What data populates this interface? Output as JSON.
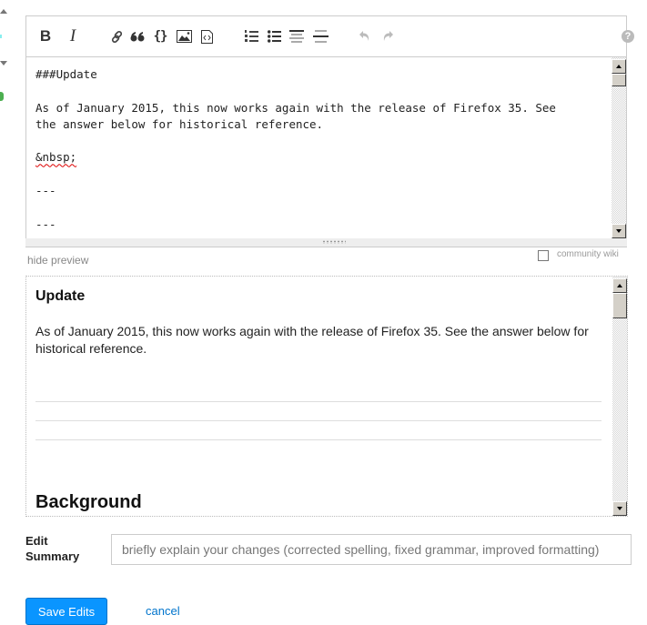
{
  "toolbar": {
    "buttons": [
      {
        "name": "bold",
        "icon": "bold-icon",
        "label": "B"
      },
      {
        "name": "italic",
        "icon": "italic-icon",
        "label": "I"
      },
      {
        "name": "link",
        "icon": "link-icon"
      },
      {
        "name": "blockquote",
        "icon": "quote-icon"
      },
      {
        "name": "code",
        "icon": "code-braces-icon",
        "label": "{}"
      },
      {
        "name": "image",
        "icon": "image-icon"
      },
      {
        "name": "snippet",
        "icon": "snippet-icon"
      },
      {
        "name": "ordered-list",
        "icon": "ordered-list-icon"
      },
      {
        "name": "bulleted-list",
        "icon": "bulleted-list-icon"
      },
      {
        "name": "heading",
        "icon": "heading-icon"
      },
      {
        "name": "horizontal-rule",
        "icon": "horizontal-rule-icon"
      },
      {
        "name": "undo",
        "icon": "undo-icon"
      },
      {
        "name": "redo",
        "icon": "redo-icon"
      }
    ],
    "help_label": "?"
  },
  "editor": {
    "lines": [
      "###Update",
      "",
      "As of January 2015, this now works again with the release of Firefox 35. See",
      "the answer below for historical reference.",
      "",
      "&nbsp;",
      "",
      "---",
      "",
      "---"
    ]
  },
  "preview_toggle": {
    "label": "hide preview"
  },
  "community_wiki": {
    "label": "community wiki",
    "checked": false
  },
  "preview": {
    "heading": "Update",
    "paragraph": "As of January 2015, this now works again with the release of Firefox 35. See the answer below for historical reference.",
    "section_heading": "Background"
  },
  "edit_summary": {
    "label_line1": "Edit",
    "label_line2": "Summary",
    "placeholder": "briefly explain your changes (corrected spelling, fixed grammar, improved formatting)",
    "value": ""
  },
  "actions": {
    "save_label": "Save Edits",
    "cancel_label": "cancel"
  }
}
